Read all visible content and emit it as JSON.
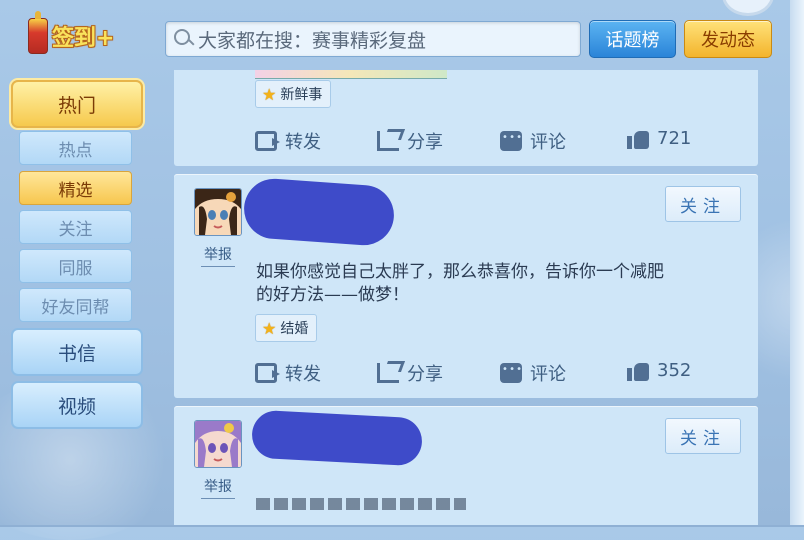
{
  "topbar": {
    "signin_label": "签到+",
    "search_placeholder": "大家都在搜：赛事精彩复盘",
    "topic_button": "话题榜",
    "post_button": "发动态"
  },
  "sidebar": {
    "hot": "热门",
    "sub": [
      "热点",
      "精选",
      "关注",
      "同服",
      "好友同帮"
    ],
    "active_sub_index": 1,
    "mail": "书信",
    "video": "视频"
  },
  "feed": {
    "post1": {
      "tag": "新鲜事",
      "actions": {
        "forward": "转发",
        "share": "分享",
        "comment": "评论",
        "likes": "721"
      }
    },
    "post2": {
      "follow": "关注",
      "report": "举报",
      "text_line1": "如果你感觉自己太胖了，那么恭喜你，告诉你一个减肥",
      "text_line2": "的好方法——做梦！",
      "tag": "结婚",
      "actions": {
        "forward": "转发",
        "share": "分享",
        "comment": "评论",
        "likes": "352"
      }
    },
    "post3": {
      "follow": "关注",
      "report": "举报"
    }
  },
  "colors": {
    "accent_blue": "#2a84d8",
    "accent_gold": "#f3b42c",
    "card_bg": "#cfe6f8"
  },
  "icons": [
    "search-icon",
    "lantern-icon",
    "forward-icon",
    "share-icon",
    "comment-icon",
    "like-icon",
    "star-icon"
  ]
}
